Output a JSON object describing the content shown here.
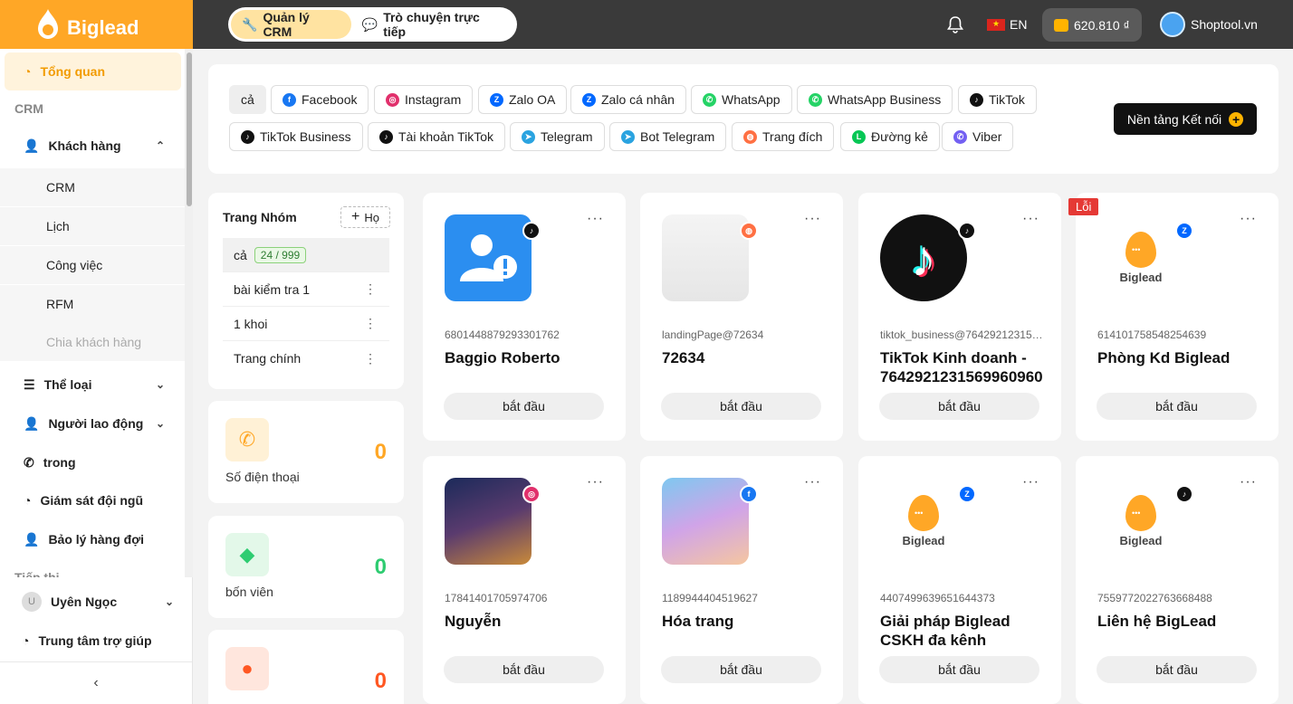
{
  "app": {
    "logo_text": "Biglead",
    "tabs": [
      {
        "label": "Quản lý CRM",
        "icon": "wrench-icon"
      },
      {
        "label": "Trò chuyện trực tiếp",
        "icon": "chat-icon"
      }
    ],
    "language": "EN",
    "balance": "620.810 ₫",
    "account_name": "Shoptool.vn"
  },
  "sidebar": {
    "overview": "Tổng quan",
    "section_crm": "CRM",
    "customers": "Khách hàng",
    "customer_sub": [
      "CRM",
      "Lịch",
      "Công việc",
      "RFM",
      "Chia khách hàng"
    ],
    "categories": "Thể loại",
    "workers": "Người lao động",
    "inside": "trong",
    "team_monitor": "Giám sát đội ngũ",
    "queue_manage": "Bảo lý hàng đợi",
    "section_marketing": "Tiếp thị",
    "user_initial": "U",
    "user_name": "Uyên Ngọc",
    "help": "Trung tâm trợ giúp",
    "collapse_glyph": "‹"
  },
  "platforms": {
    "all_label": "cả",
    "items": [
      {
        "label": "Facebook",
        "color": "#1877f2",
        "glyph": "f"
      },
      {
        "label": "Instagram",
        "color": "#e1306c",
        "glyph": "◎"
      },
      {
        "label": "Zalo OA",
        "color": "#0068ff",
        "glyph": "Z"
      },
      {
        "label": "Zalo cá nhân",
        "color": "#0068ff",
        "glyph": "Z"
      },
      {
        "label": "WhatsApp",
        "color": "#25d366",
        "glyph": "✆"
      },
      {
        "label": "WhatsApp Business",
        "color": "#25d366",
        "glyph": "✆"
      },
      {
        "label": "TikTok",
        "color": "#111111",
        "glyph": "♪"
      },
      {
        "label": "TikTok Business",
        "color": "#111111",
        "glyph": "♪"
      },
      {
        "label": "Tài khoản TikTok",
        "color": "#111111",
        "glyph": "♪"
      },
      {
        "label": "Telegram",
        "color": "#2aa3e0",
        "glyph": "➤"
      },
      {
        "label": "Bot Telegram",
        "color": "#2aa3e0",
        "glyph": "➤"
      },
      {
        "label": "Trang đích",
        "color": "#ff7043",
        "glyph": "◍"
      },
      {
        "label": "Đường kẻ",
        "color": "#06c755",
        "glyph": "L"
      },
      {
        "label": "Viber",
        "color": "#7360f2",
        "glyph": "✆"
      }
    ],
    "connect_label": "Nền tảng Kết nối"
  },
  "groups": {
    "title": "Trang Nhóm",
    "add_label": "Họ",
    "rows": [
      {
        "label": "cả",
        "badge": "24 / 999"
      },
      {
        "label": "bài kiểm tra 1"
      },
      {
        "label": "1 khoi"
      },
      {
        "label": "Trang chính"
      }
    ]
  },
  "stats": [
    {
      "label": "Số điện thoại",
      "value": "0",
      "color": "#ffa726",
      "bg": "#fff1d6",
      "icon": "phone-icon"
    },
    {
      "label": "bốn viên",
      "value": "0",
      "color": "#2ecc71",
      "bg": "#e3f8e9",
      "icon": "tag-icon"
    },
    {
      "label": "",
      "value": "0",
      "color": "#ff5722",
      "bg": "#ffe6dd",
      "icon": "chat-bubble-icon"
    }
  ],
  "cards": [
    {
      "id": "6801448879293301762",
      "name": "Baggio Roberto",
      "platform": "tiktok"
    },
    {
      "id": "landingPage@72634",
      "name": "72634",
      "platform": "landing"
    },
    {
      "id": "tiktok_business@7642921231569960...",
      "name": "TikTok Kinh doanh - 7642921231569960960",
      "platform": "tiktok"
    },
    {
      "id": "614101758548254639",
      "name": "Phòng Kd Biglead",
      "platform": "zalo",
      "error": "Lỗi"
    },
    {
      "id": "17841401705974706",
      "name": "Nguyễn",
      "platform": "instagram"
    },
    {
      "id": "1189944404519627",
      "name": "Hóa trang",
      "platform": "facebook"
    },
    {
      "id": "4407499639651644373",
      "name": "Giải pháp Biglead CSKH đa kênh",
      "platform": "zalo-oa"
    },
    {
      "id": "7559772022763668488",
      "name": "Liên hệ BigLead",
      "platform": "tiktok"
    }
  ],
  "card_button_label": "bắt đầu",
  "card_menu_glyph": "···"
}
